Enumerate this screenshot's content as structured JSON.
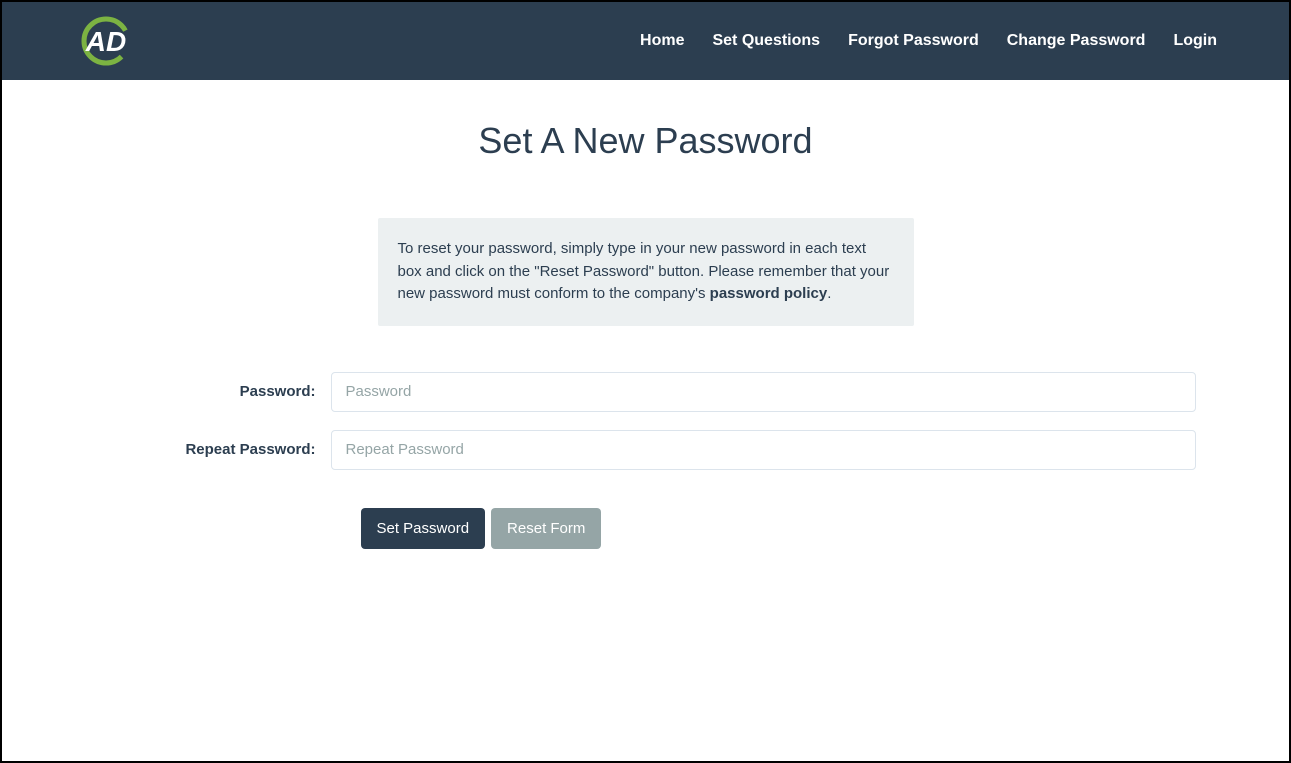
{
  "nav": {
    "items": [
      {
        "label": "Home"
      },
      {
        "label": "Set Questions"
      },
      {
        "label": "Forgot Password"
      },
      {
        "label": "Change Password"
      },
      {
        "label": "Login"
      }
    ]
  },
  "page": {
    "title": "Set A New Password"
  },
  "info": {
    "text_prefix": "To reset your password, simply type in your new password in each text box and click on the \"Reset Password\" button. Please remember that your new password must conform to the company's ",
    "bold": "password policy",
    "suffix": "."
  },
  "form": {
    "password_label": "Password:",
    "password_placeholder": "Password",
    "repeat_label": "Repeat Password:",
    "repeat_placeholder": "Repeat Password",
    "submit_label": "Set Password",
    "reset_label": "Reset Form"
  }
}
